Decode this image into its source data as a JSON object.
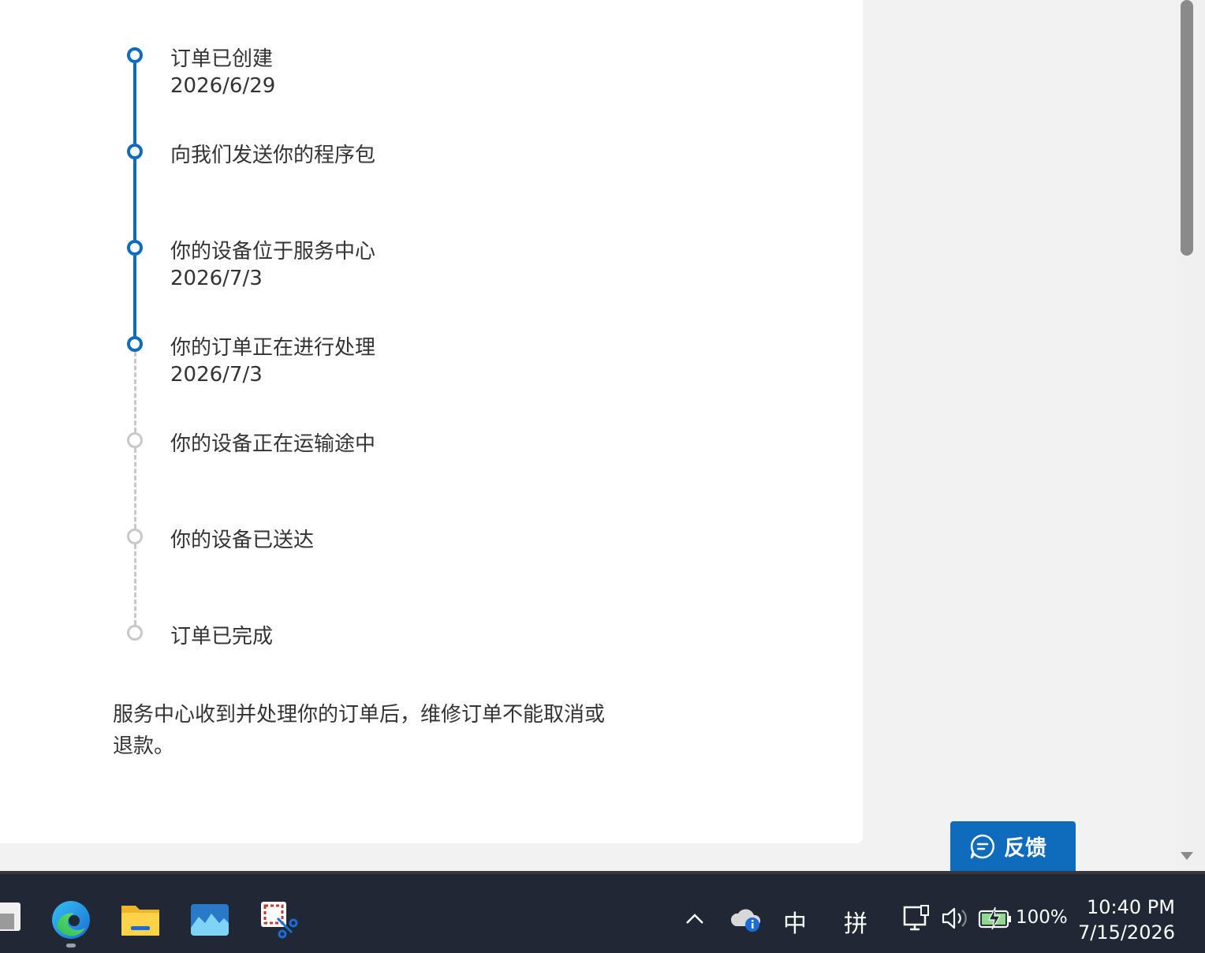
{
  "steps": [
    {
      "title": "订单已创建",
      "date": "2026/6/29",
      "status": "done"
    },
    {
      "title": "向我们发送你的程序包",
      "date": "",
      "status": "done"
    },
    {
      "title": "你的设备位于服务中心",
      "date": "2026/7/3",
      "status": "done"
    },
    {
      "title": "你的订单正在进行处理",
      "date": "2026/7/3",
      "status": "done"
    },
    {
      "title": "你的设备正在运输途中",
      "date": "",
      "status": "todo"
    },
    {
      "title": "你的设备已送达",
      "date": "",
      "status": "todo"
    },
    {
      "title": "订单已完成",
      "date": "",
      "status": "todo"
    }
  ],
  "note": "服务中心收到并处理你的订单后，维修订单不能取消或退款。",
  "feedback_label": "反馈",
  "taskbar": {
    "ime_mode": "中",
    "ime_pinyin": "拼",
    "battery": "100%",
    "time": "10:40 PM",
    "date": "7/15/2026"
  },
  "colors": {
    "accent": "#0f6cbd",
    "pending": "#c8c8c8"
  }
}
